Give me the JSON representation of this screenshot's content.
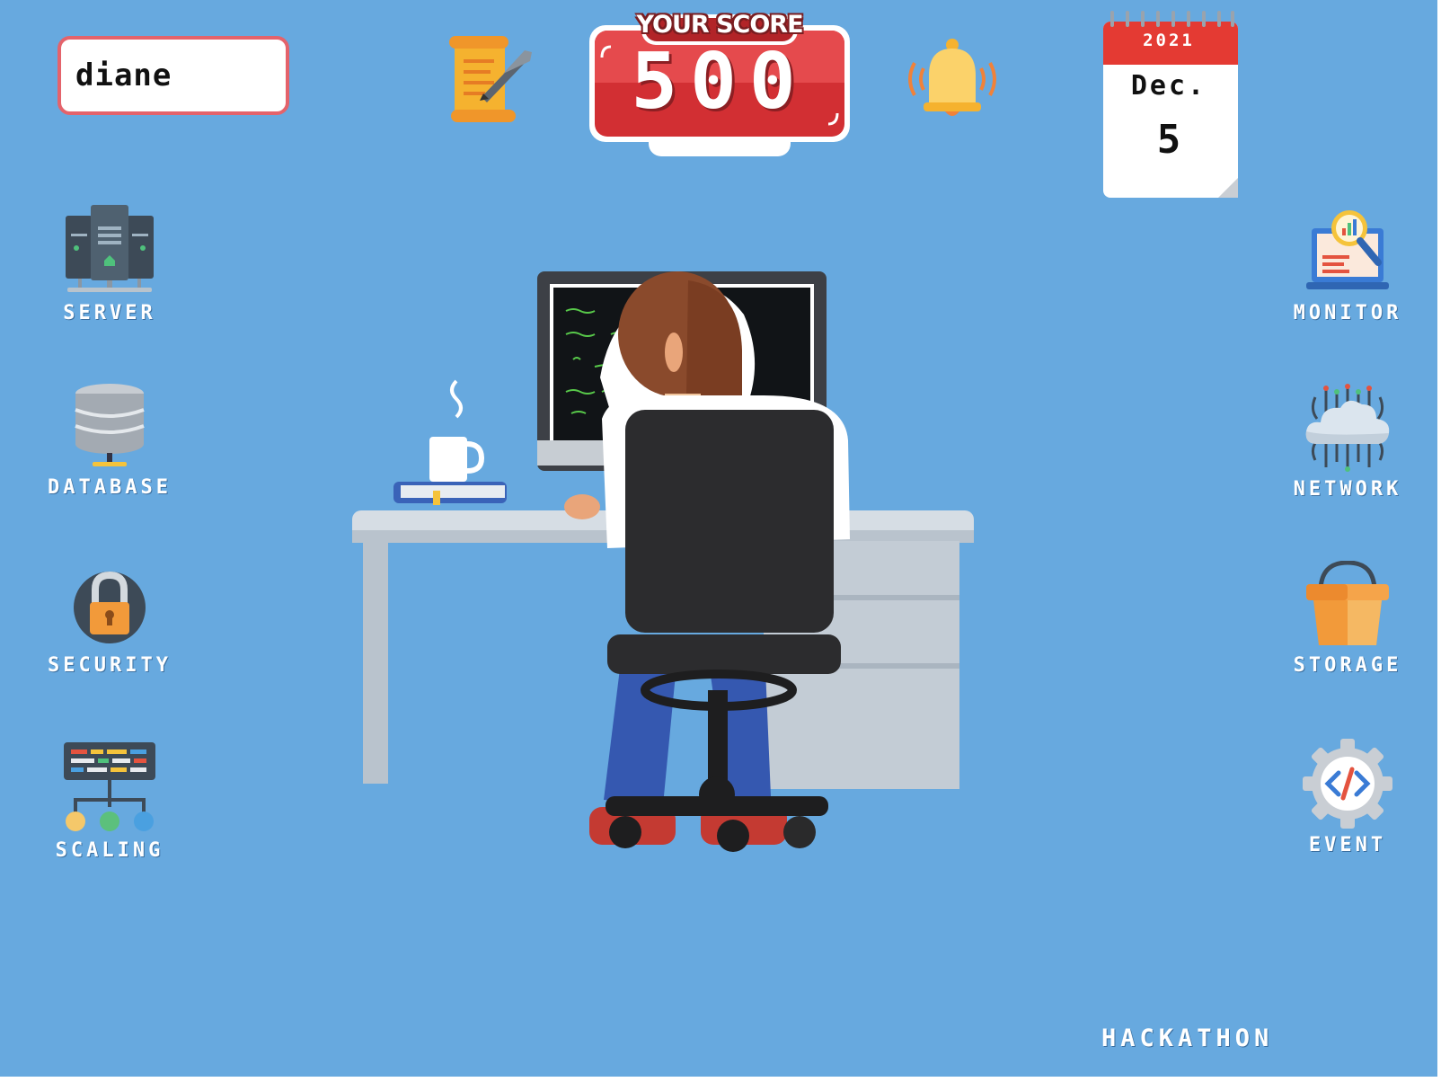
{
  "user": {
    "name": "diane"
  },
  "score": {
    "label": "YOUR SCORE",
    "value": "500"
  },
  "calendar": {
    "year": "2021",
    "month": "Dec.",
    "day": "5"
  },
  "left_menu": [
    {
      "label": "SERVER",
      "icon": "server-icon"
    },
    {
      "label": "DATABASE",
      "icon": "database-icon"
    },
    {
      "label": "SECURITY",
      "icon": "lock-icon"
    },
    {
      "label": "SCALING",
      "icon": "scaling-icon"
    }
  ],
  "right_menu": [
    {
      "label": "MONITOR",
      "icon": "monitor-icon"
    },
    {
      "label": "NETWORK",
      "icon": "cloud-network-icon"
    },
    {
      "label": "STORAGE",
      "icon": "bucket-icon"
    },
    {
      "label": "EVENT",
      "icon": "code-gear-icon"
    }
  ],
  "footer": {
    "hackathon_label": "HACKATHON"
  },
  "toolbar": {
    "scroll_icon": "scroll-quill-icon",
    "bell_icon": "bell-icon"
  },
  "colors": {
    "background": "#67a9df",
    "score_red": "#d22f33",
    "calendar_red": "#e43a33",
    "username_border": "#e4636b"
  }
}
